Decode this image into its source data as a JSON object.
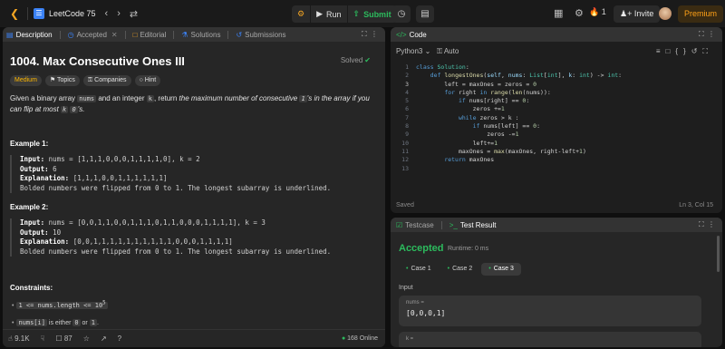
{
  "topbar": {
    "title": "LeetCode 75",
    "run_label": "Run",
    "submit_label": "Submit",
    "streak": "1",
    "invite_label": "Invite",
    "premium_label": "Premium"
  },
  "left_tabs": [
    {
      "label": "Description",
      "icon": "document-icon"
    },
    {
      "label": "Accepted",
      "icon": "clock-icon"
    },
    {
      "label": "Editorial",
      "icon": "book-icon"
    },
    {
      "label": "Solutions",
      "icon": "flask-icon"
    },
    {
      "label": "Submissions",
      "icon": "history-icon"
    }
  ],
  "problem": {
    "title": "1004. Max Consecutive Ones III",
    "status": "Solved",
    "tags": [
      "Medium",
      "Topics",
      "Companies",
      "Hint"
    ],
    "desc_a": "Given a binary array ",
    "desc_nums": "nums",
    "desc_b": " and an integer ",
    "desc_k": "k",
    "desc_c": ", return ",
    "desc_d": "the maximum number of consecutive ",
    "desc_one": "1",
    "desc_e": "'s in the array if you can flip at most ",
    "desc_k2": "k",
    "desc_zero": "0",
    "desc_f": "'s."
  },
  "examples": [
    {
      "header": "Example 1:",
      "input_label": "Input:",
      "input": "nums = [1,1,1,0,0,0,1,1,1,1,0], k = 2",
      "output_label": "Output:",
      "output": "6",
      "explanation_label": "Explanation:",
      "explanation": "[1,1,1,0,0,1,1,1,1,1,1]",
      "note": "Bolded numbers were flipped from 0 to 1. The longest subarray is underlined."
    },
    {
      "header": "Example 2:",
      "input_label": "Input:",
      "input": "nums = [0,0,1,1,0,0,1,1,1,0,1,1,0,0,0,1,1,1,1], k = 3",
      "output_label": "Output:",
      "output": "10",
      "explanation_label": "Explanation:",
      "explanation": "[0,0,1,1,1,1,1,1,1,1,1,1,0,0,0,1,1,1,1]",
      "note": "Bolded numbers were flipped from 0 to 1. The longest subarray is underlined."
    }
  ],
  "constraints": {
    "header": "Constraints:",
    "c1": "1 <= nums.length <= 10",
    "c1_exp": "5",
    "c2_code": "nums[i]",
    "c2_a": " is either ",
    "c2_zero": "0",
    "c2_b": " or ",
    "c2_one": "1",
    "c2_end": "."
  },
  "footer": {
    "likes": "9.1K",
    "comments": "87",
    "online": "168 Online"
  },
  "code_panel": {
    "tab_label": "Code",
    "language": "Python3",
    "auto_label": "Auto",
    "status": "Saved",
    "cursor": "Ln 3, Col 15",
    "line_numbers": [
      "1",
      "2",
      "3",
      "4",
      "5",
      "6",
      "7",
      "8",
      "9",
      "10",
      "11",
      "12",
      "13"
    ]
  },
  "result_panel": {
    "tab_testcase": "Testcase",
    "tab_result": "Test Result",
    "verdict": "Accepted",
    "runtime": "Runtime: 0 ms",
    "cases": [
      "Case 1",
      "Case 2",
      "Case 3"
    ],
    "input_label": "Input",
    "var1": "nums =",
    "val1": "[0,0,0,1]",
    "var2": "k ="
  },
  "colors": {
    "accent_green": "#2cbb5d",
    "accent_orange": "#ffa116",
    "medium": "#ffb800"
  }
}
